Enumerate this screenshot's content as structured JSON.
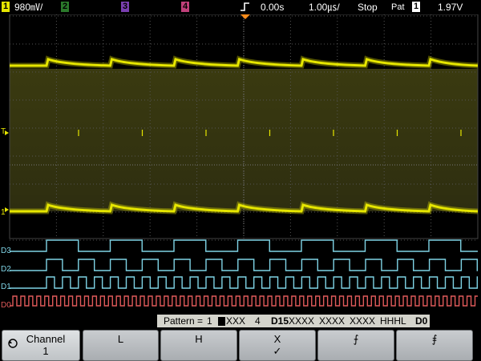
{
  "status_bar": {
    "ch1_number": "1",
    "ch1_scale": "980㎷/",
    "ch2_number": "2",
    "ch3_number": "3",
    "ch4_number": "4",
    "trigger_icon": "rising-edge-icon",
    "time_offset": "0.00s",
    "time_scale": "1.00㎲/",
    "run_state": "Stop",
    "trigger_mode_label": "Pat",
    "trigger_source": "1",
    "trigger_level": "1.97V"
  },
  "markers": {
    "trigger_level": "T",
    "ch1_ground": "1",
    "digital": [
      "D3",
      "D2",
      "D1",
      "D0"
    ]
  },
  "pattern_bar": {
    "label": "Pattern =",
    "analog_ch1": "1",
    "analog_ch2_4": "XXX",
    "analog_ch4": "4",
    "digital_label": "D15",
    "digital_groups": [
      "XXXX",
      "XXXX",
      "XXXX",
      "HHHL"
    ],
    "d0_label": "D0"
  },
  "softkeys": {
    "channel_line1": "Channel",
    "channel_line2": "1",
    "low": "L",
    "high": "H",
    "dont_care": "X",
    "dont_care_check": "✓",
    "rising": "⨍",
    "falling": "⨎"
  },
  "colors": {
    "ch1": "#e6e600",
    "digital_blue": "#7fd4e6",
    "digital_d0": "#e05a5a",
    "graticule": "#555555",
    "softkey": "#b8bbbe"
  }
}
